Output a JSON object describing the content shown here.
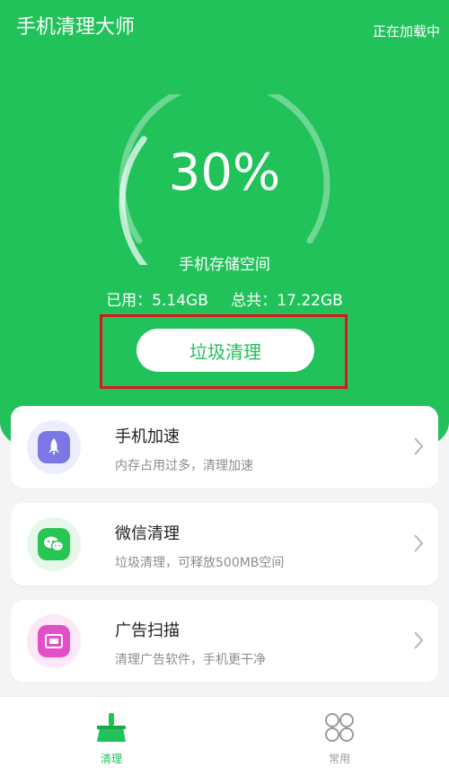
{
  "header": {
    "app_title": "手机清理大师",
    "status": "正在加载中"
  },
  "storage": {
    "percent_text": "30%",
    "used_fraction": 0.3,
    "label": "手机存储空间",
    "used_text": "已用：5.14GB",
    "total_text": "总共：17.22GB"
  },
  "primary_action": {
    "label": "垃圾清理"
  },
  "features": [
    {
      "title": "手机加速",
      "desc": "内存占用过多，清理加速",
      "icon": "rocket-icon",
      "accent": "#7b78e6"
    },
    {
      "title": "微信清理",
      "desc": "垃圾清理，可释放500MB空间",
      "icon": "wechat-icon",
      "accent": "#27c552"
    },
    {
      "title": "广告扫描",
      "desc": "清理广告软件，手机更干净",
      "icon": "ad-icon",
      "accent": "#e34fc6"
    }
  ],
  "tabbar": {
    "items": [
      {
        "label": "清理",
        "icon": "broom-icon",
        "active": true
      },
      {
        "label": "常用",
        "icon": "grid-icon",
        "active": false
      }
    ]
  },
  "colors": {
    "brand_green": "#22c25b",
    "highlight_red": "#d8171b",
    "inactive_gray": "#9a9a9a"
  }
}
